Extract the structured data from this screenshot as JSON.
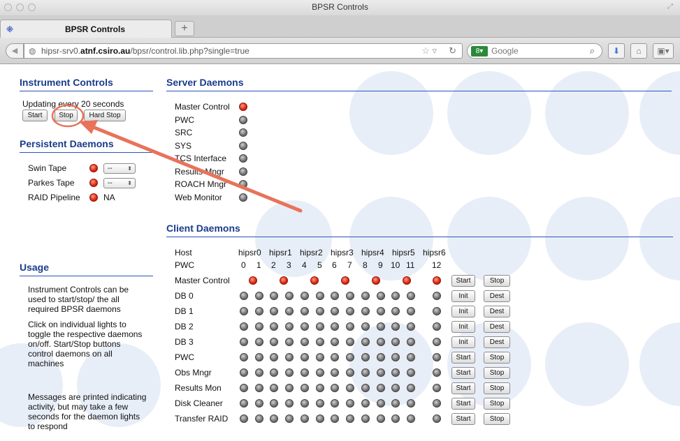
{
  "window": {
    "title": "BPSR Controls"
  },
  "tab": {
    "label": "BPSR Controls",
    "new_tab": "+"
  },
  "url": {
    "prefix": "hipsr-srv0.",
    "domain": "atnf.csiro.au",
    "path": "/bpsr/control.lib.php?single=true"
  },
  "search": {
    "engine_badge": "8",
    "placeholder": "Google"
  },
  "instrument_controls": {
    "title": "Instrument Controls",
    "status": "Updating every 20 seconds",
    "buttons": [
      "Start",
      "Stop",
      "Hard Stop"
    ]
  },
  "persistent_daemons": {
    "title": "Persistent Daemons",
    "items": [
      {
        "label": "Swin Tape",
        "state": "red",
        "select": "--"
      },
      {
        "label": "Parkes Tape",
        "state": "red",
        "select": "--"
      },
      {
        "label": "RAID Pipeline",
        "state": "red",
        "value": "NA"
      }
    ]
  },
  "server_daemons": {
    "title": "Server Daemons",
    "items": [
      {
        "label": "Master Control",
        "state": "red"
      },
      {
        "label": "PWC",
        "state": "grey"
      },
      {
        "label": "SRC",
        "state": "grey"
      },
      {
        "label": "SYS",
        "state": "grey"
      },
      {
        "label": "TCS Interface",
        "state": "grey"
      },
      {
        "label": "Results Mngr",
        "state": "grey"
      },
      {
        "label": "ROACH Mngr",
        "state": "grey"
      },
      {
        "label": "Web Monitor",
        "state": "grey"
      }
    ]
  },
  "client_daemons": {
    "title": "Client Daemons",
    "host_label": "Host",
    "pwc_label": "PWC",
    "hosts": [
      "hipsr0",
      "hipsr1",
      "hipsr2",
      "hipsr3",
      "hipsr4",
      "hipsr5",
      "hipsr6"
    ],
    "pwcs": [
      "0",
      "1",
      "2",
      "3",
      "4",
      "5",
      "6",
      "7",
      "8",
      "9",
      "10",
      "11",
      "12"
    ],
    "rows": [
      {
        "label": "Master Control",
        "type": "host",
        "buttons": [
          "Start",
          "Stop"
        ]
      },
      {
        "label": "DB 0",
        "type": "pwc",
        "buttons": [
          "Init",
          "Dest"
        ]
      },
      {
        "label": "DB 1",
        "type": "pwc",
        "buttons": [
          "Init",
          "Dest"
        ]
      },
      {
        "label": "DB 2",
        "type": "pwc",
        "buttons": [
          "Init",
          "Dest"
        ]
      },
      {
        "label": "DB 3",
        "type": "pwc",
        "buttons": [
          "Init",
          "Dest"
        ]
      },
      {
        "label": "PWC",
        "type": "pwc",
        "buttons": [
          "Start",
          "Stop"
        ]
      },
      {
        "label": "Obs Mngr",
        "type": "pwc",
        "buttons": [
          "Start",
          "Stop"
        ]
      },
      {
        "label": "Results Mon",
        "type": "pwc",
        "buttons": [
          "Start",
          "Stop"
        ]
      },
      {
        "label": "Disk Cleaner",
        "type": "pwc",
        "buttons": [
          "Start",
          "Stop"
        ]
      },
      {
        "label": "Transfer RAID",
        "type": "pwc",
        "buttons": [
          "Start",
          "Stop"
        ]
      }
    ]
  },
  "usage": {
    "title": "Usage",
    "paragraphs": [
      "Instrument Controls can be used to start/stop/ the all required BPSR daemons",
      "Click on individual lights to toggle the respective daemons on/off. Start/Stop buttons control daemons on all machines",
      "Messages are printed indicating activity, but may take a few seconds for the daemon lights to respond"
    ]
  },
  "colors": {
    "heading": "#1a3b8c",
    "rule": "#2a52be",
    "light_on": "#e02a12",
    "light_off": "#777777",
    "annotation": "#e8735a"
  }
}
